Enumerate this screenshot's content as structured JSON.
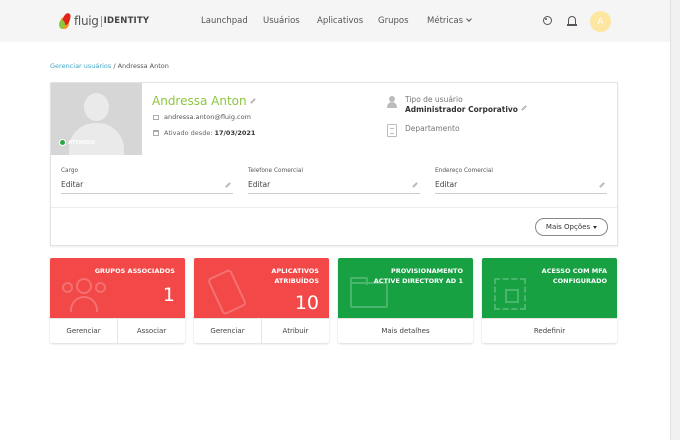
{
  "header": {
    "brand": "fluig",
    "product": "IDENTITY",
    "nav": [
      {
        "label": "Launchpad"
      },
      {
        "label": "Usuários"
      },
      {
        "label": "Aplicativos"
      },
      {
        "label": "Grupos"
      },
      {
        "label": "Métricas"
      }
    ],
    "avatar_initial": "A"
  },
  "breadcrumb": {
    "link": "Gerenciar usuários",
    "separator": "/",
    "current": "Andressa Anton"
  },
  "profile": {
    "name": "Andressa Anton",
    "email": "andressa.anton@fluig.com",
    "since_label": "Ativado desde:",
    "since_date": "17/03/2021",
    "status": "ATIVADO",
    "type_label": "Tipo de usuário",
    "type_value": "Administrador Corporativo",
    "dept_label": "Departamento",
    "fields": [
      {
        "label": "Cargo",
        "value": "Editar"
      },
      {
        "label": "Telefone Comercial",
        "value": "Editar"
      },
      {
        "label": "Endereço Comercial",
        "value": "Editar"
      }
    ],
    "more_button": "Mais Opções"
  },
  "cards": [
    {
      "title": "GRUPOS ASSOCIADOS",
      "subtitle": "",
      "number": "1",
      "color": "#f24848",
      "actions": [
        "Gerenciar",
        "Associar"
      ]
    },
    {
      "title": "APLICATIVOS",
      "subtitle": "ATRIBUÍDOS",
      "number": "10",
      "color": "#f24848",
      "actions": [
        "Gerenciar",
        "Atribuir"
      ]
    },
    {
      "title": "PROVISIONAMENTO",
      "subtitle": "ACTIVE DIRECTORY AD 1",
      "number": "",
      "color": "#17a142",
      "actions": [
        "Mais detalhes"
      ]
    },
    {
      "title": "ACESSO COM MFA",
      "subtitle": "CONFIGURADO",
      "number": "",
      "color": "#17a142",
      "actions": [
        "Redefinir"
      ]
    }
  ]
}
